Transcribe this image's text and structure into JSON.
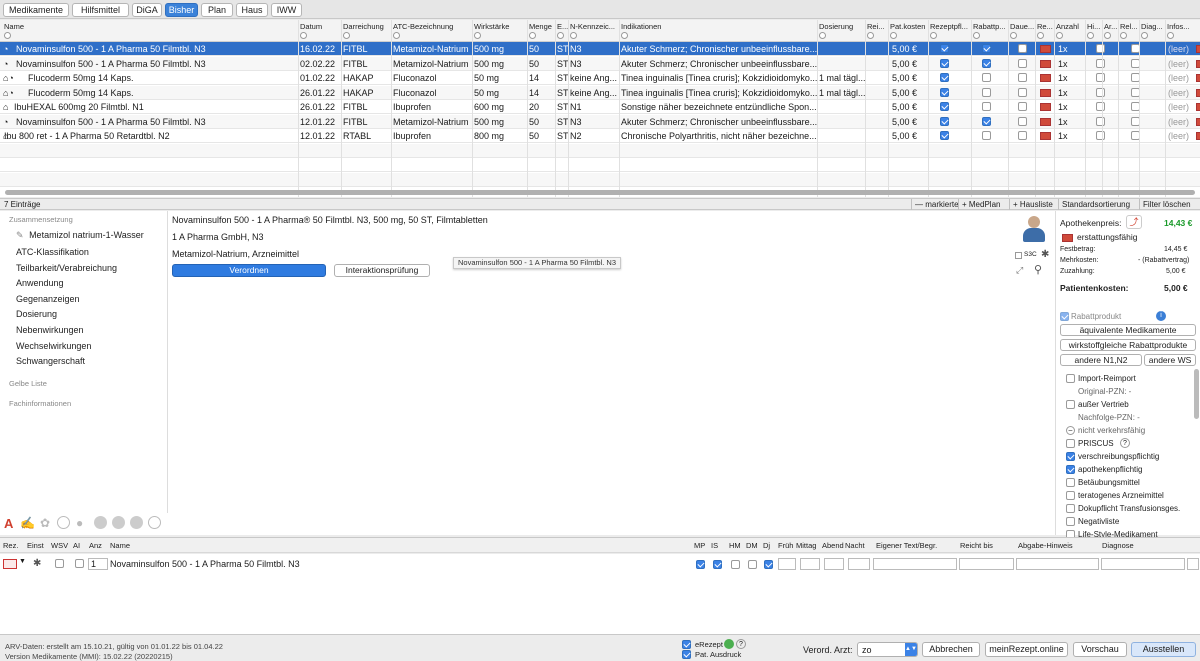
{
  "tabs": [
    "Medikamente",
    "Hilfsmittel",
    "DiGA",
    "Bisher",
    "Plan",
    "Haus",
    "IWW"
  ],
  "active_tab": "Bisher",
  "grid": {
    "headers": [
      "Name",
      "Datum",
      "Darreichung",
      "ATC-Bezeichnung",
      "Wirkstärke",
      "Menge",
      "E...",
      "N-Kennzeic...",
      "Indikationen",
      "Dosierung",
      "Rei...",
      "Pat.kosten",
      "Rezeptpfl...",
      "Rabattp...",
      "Daue...",
      "Re...",
      "Anzahl",
      "Hi...",
      "Ar...",
      "Rel...",
      "Diag...",
      "Infos..."
    ],
    "rows": [
      {
        "name": "Novaminsulfon 500 - 1 A Pharma 50 Filmtbl. N3",
        "datum": "16.02.22",
        "darr": "FITBL",
        "atc": "Metamizol-Natrium",
        "staerke": "500 mg",
        "menge": "50",
        "e": "ST",
        "n": "N3",
        "ind": "Akuter Schmerz; Chronischer unbeeinflussbare...",
        "dos": "",
        "kosten": "5,00 €",
        "rezept": true,
        "rabatt": true,
        "anzahl": "1x",
        "info": "(leer)",
        "selected": true
      },
      {
        "name": "Novaminsulfon 500 - 1 A Pharma 50 Filmtbl. N3",
        "datum": "02.02.22",
        "darr": "FITBL",
        "atc": "Metamizol-Natrium",
        "staerke": "500 mg",
        "menge": "50",
        "e": "ST",
        "n": "N3",
        "ind": "Akuter Schmerz; Chronischer unbeeinflussbare...",
        "dos": "",
        "kosten": "5,00 €",
        "rezept": true,
        "rabatt": true,
        "anzahl": "1x",
        "info": "(leer)",
        "selected": false
      },
      {
        "name": "Flucoderm 50mg 14 Kaps.",
        "datum": "01.02.22",
        "darr": "HAKAP",
        "atc": "Fluconazol",
        "staerke": "50 mg",
        "menge": "14",
        "e": "ST",
        "n": "keine Ang...",
        "ind": "Tinea inguinalis [Tinea cruris]; Kokzidioidomyko...",
        "dos": "1 mal tägl...",
        "kosten": "5,00 €",
        "rezept": true,
        "rabatt": false,
        "anzahl": "1x",
        "info": "(leer)",
        "selected": false
      },
      {
        "name": "Flucoderm 50mg 14 Kaps.",
        "datum": "26.01.22",
        "darr": "HAKAP",
        "atc": "Fluconazol",
        "staerke": "50 mg",
        "menge": "14",
        "e": "ST",
        "n": "keine Ang...",
        "ind": "Tinea inguinalis [Tinea cruris]; Kokzidioidomyko...",
        "dos": "1 mal tägl...",
        "kosten": "5,00 €",
        "rezept": true,
        "rabatt": false,
        "anzahl": "1x",
        "info": "(leer)",
        "selected": false
      },
      {
        "name": "IbuHEXAL 600mg 20 Filmtbl. N1",
        "datum": "26.01.22",
        "darr": "FITBL",
        "atc": "Ibuprofen",
        "staerke": "600 mg",
        "menge": "20",
        "e": "ST",
        "n": "N1",
        "ind": "Sonstige näher bezeichnete entzündliche Spon...",
        "dos": "",
        "kosten": "5,00 €",
        "rezept": true,
        "rabatt": false,
        "anzahl": "1x",
        "info": "(leer)",
        "selected": false
      },
      {
        "name": "Novaminsulfon 500 - 1 A Pharma 50 Filmtbl. N3",
        "datum": "12.01.22",
        "darr": "FITBL",
        "atc": "Metamizol-Natrium",
        "staerke": "500 mg",
        "menge": "50",
        "e": "ST",
        "n": "N3",
        "ind": "Akuter Schmerz; Chronischer unbeeinflussbare...",
        "dos": "",
        "kosten": "5,00 €",
        "rezept": true,
        "rabatt": true,
        "anzahl": "1x",
        "info": "(leer)",
        "selected": false
      },
      {
        "name": "Ibu 800 ret - 1 A Pharma 50 Retardtbl. N2",
        "datum": "12.01.22",
        "darr": "RTABL",
        "atc": "Ibuprofen",
        "staerke": "800 mg",
        "menge": "50",
        "e": "ST",
        "n": "N2",
        "ind": "Chronische Polyarthritis, nicht näher bezeichne...",
        "dos": "",
        "kosten": "5,00 €",
        "rezept": true,
        "rabatt": false,
        "anzahl": "1x",
        "info": "(leer)",
        "selected": false
      }
    ]
  },
  "status": {
    "count": "7 Einträge",
    "markierte": "— markierte",
    "medplan": "+ MedPlan",
    "hausliste": "+ Hausliste",
    "sort": "Standardsortierung",
    "filter": "Filter löschen"
  },
  "leftnav": {
    "section1": "Zusammensetzung",
    "substance": "Metamizol natrium-1-Wasser",
    "items": [
      "ATC-Klassifikation",
      "Teilbarkeit/Verabreichung",
      "Anwendung",
      "Gegenanzeigen",
      "Dosierung",
      "Nebenwirkungen",
      "Wechselwirkungen",
      "Schwangerschaft"
    ],
    "section2": "Gelbe Liste",
    "section3": "Fachinformationen"
  },
  "detail": {
    "title": "Novaminsulfon 500 - 1 A Pharma® 50 Filmtbl. N3, 500 mg, 50 ST, Filmtabletten",
    "maker": "1 A Pharma GmbH, N3",
    "substance": "Metamizol-Natrium, Arzneimittel",
    "btn_verordnen": "Verordnen",
    "btn_interaktion": "Interaktionsprüfung",
    "tooltip": "Novaminsulfon 500 - 1 A Pharma 50 Filmtbl. N3",
    "ssc_label": "S3C"
  },
  "price": {
    "label": "Apothekenpreis:",
    "value": "14,43 €",
    "erstattung": "erstattungsfähig",
    "festbetrag_label": "Festbetrag:",
    "festbetrag": "14,45 €",
    "mehrkosten_label": "Mehrkosten:",
    "mehrkosten": "- (Rabattvertrag)",
    "zuzahlung_label": "Zuzahlung:",
    "zuzahlung": "5,00 €",
    "patkosten_label": "Patientenkosten:",
    "patkosten": "5,00 €",
    "rabattprodukt": "Rabattprodukt",
    "btn_aequiv": "äquivalente Medikamente",
    "btn_wirkstoff": "wirkstoffgleiche Rabattprodukte",
    "btn_n1n2": "andere N1,N2",
    "btn_ws": "andere WS"
  },
  "props": [
    {
      "label": "Import-Reimport",
      "checked": false
    },
    {
      "label": "Original-PZN: -",
      "sub": true
    },
    {
      "label": "außer Vertrieb",
      "checked": false
    },
    {
      "label": "Nachfolge-PZN: -",
      "sub": true
    },
    {
      "label": "nicht verkehrsfähig",
      "minus": true
    },
    {
      "label": "PRISCUS",
      "checked": false,
      "help": "?"
    },
    {
      "label": "verschreibungspflichtig",
      "checked": true
    },
    {
      "label": "apothekenpflichtig",
      "checked": true
    },
    {
      "label": "Betäubungsmittel",
      "checked": false
    },
    {
      "label": "teratogenes Arzneimittel",
      "checked": false
    },
    {
      "label": "Dokupflicht Transfusionsges.",
      "checked": false
    },
    {
      "label": "Negativliste",
      "checked": false
    },
    {
      "label": "Life-Style-Medikament",
      "checked": false
    }
  ],
  "rx": {
    "headers": [
      "Rez.",
      "Einst",
      "WSV",
      "AI",
      "Anz",
      "Name",
      "MP",
      "IS",
      "HM",
      "DM",
      "Dj",
      "Früh",
      "Mittag",
      "Abend",
      "Nacht",
      "Eigener Text/Begr.",
      "Reicht bis",
      "Abgabe-Hinweis",
      "Diagnose"
    ],
    "anz": "1",
    "name": "Novaminsulfon 500 - 1 A Pharma 50 Filmtbl. N3"
  },
  "footer": {
    "arv": "ARV-Daten: erstellt am 15.10.21, gültig von 01.01.22 bis 01.04.22",
    "version": "Version Medikamente (MMI): 15.02.22 (20220215)",
    "erezept": "eRezept",
    "patausdruck": "Pat. Ausdruck",
    "arzt_label": "Verord. Arzt:",
    "arzt_value": "zo",
    "btn_abbrechen": "Abbrechen",
    "btn_meinrezept": "meinRezept.online",
    "btn_vorschau": "Vorschau",
    "btn_ausstellen": "Ausstellen"
  },
  "colors": {
    "accent": "#2f6fc8",
    "price_green": "#1a9a2a"
  }
}
